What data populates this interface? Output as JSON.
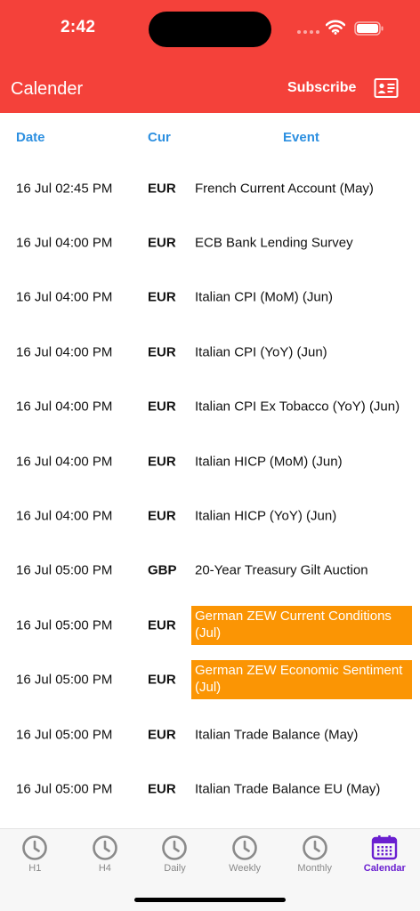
{
  "status": {
    "time": "2:42"
  },
  "header": {
    "title": "Calender",
    "subscribe_label": "Subscribe"
  },
  "columns": {
    "date": "Date",
    "cur": "Cur",
    "event": "Event"
  },
  "colors": {
    "header": "#f4413a",
    "column_header": "#2c8fe0",
    "highlight": "#fb9504",
    "active_tab": "#6a1fd0"
  },
  "rows": [
    {
      "date": "16 Jul 02:45 PM",
      "cur": "EUR",
      "event": "French Current Account (May)",
      "highlighted": false
    },
    {
      "date": "16 Jul 04:00 PM",
      "cur": "EUR",
      "event": "ECB Bank Lending Survey",
      "highlighted": false
    },
    {
      "date": "16 Jul 04:00 PM",
      "cur": "EUR",
      "event": "Italian CPI (MoM) (Jun)",
      "highlighted": false
    },
    {
      "date": "16 Jul 04:00 PM",
      "cur": "EUR",
      "event": "Italian CPI (YoY) (Jun)",
      "highlighted": false
    },
    {
      "date": "16 Jul 04:00 PM",
      "cur": "EUR",
      "event": "Italian CPI Ex Tobacco (YoY) (Jun)",
      "highlighted": false
    },
    {
      "date": "16 Jul 04:00 PM",
      "cur": "EUR",
      "event": "Italian HICP (MoM) (Jun)",
      "highlighted": false
    },
    {
      "date": "16 Jul 04:00 PM",
      "cur": "EUR",
      "event": "Italian HICP (YoY) (Jun)",
      "highlighted": false
    },
    {
      "date": "16 Jul 05:00 PM",
      "cur": "GBP",
      "event": "20-Year Treasury Gilt Auction",
      "highlighted": false
    },
    {
      "date": "16 Jul 05:00 PM",
      "cur": "EUR",
      "event": "German ZEW Current Conditions (Jul)",
      "highlighted": true
    },
    {
      "date": "16 Jul 05:00 PM",
      "cur": "EUR",
      "event": "German ZEW Economic Sentiment (Jul)",
      "highlighted": true
    },
    {
      "date": "16 Jul 05:00 PM",
      "cur": "EUR",
      "event": "Italian Trade Balance (May)",
      "highlighted": false
    },
    {
      "date": "16 Jul 05:00 PM",
      "cur": "EUR",
      "event": "Italian Trade Balance EU (May)",
      "highlighted": false
    }
  ],
  "tabs": [
    {
      "label": "H1",
      "icon": "clock-icon",
      "active": false
    },
    {
      "label": "H4",
      "icon": "clock-icon",
      "active": false
    },
    {
      "label": "Daily",
      "icon": "clock-icon",
      "active": false
    },
    {
      "label": "Weekly",
      "icon": "clock-icon",
      "active": false
    },
    {
      "label": "Monthly",
      "icon": "clock-icon",
      "active": false
    },
    {
      "label": "Calendar",
      "icon": "calendar-icon",
      "active": true
    }
  ]
}
